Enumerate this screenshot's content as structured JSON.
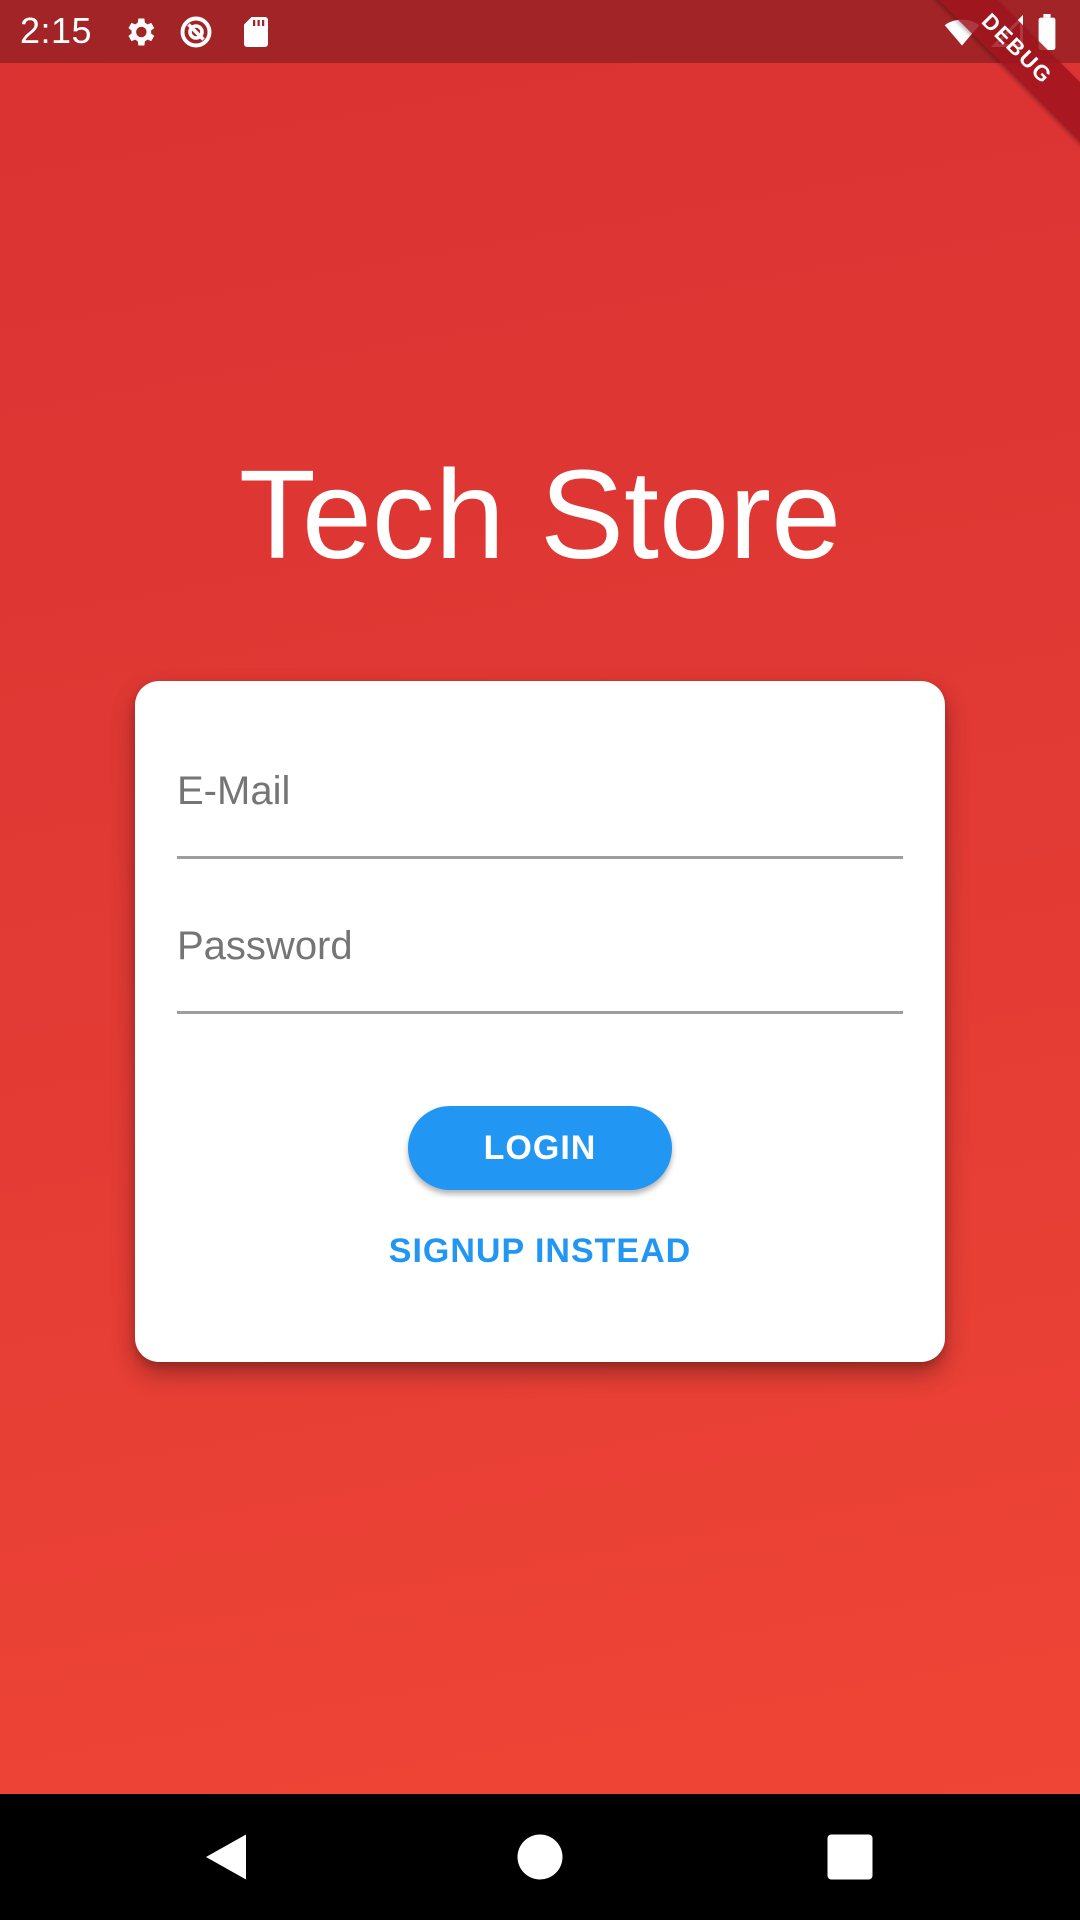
{
  "status_bar": {
    "time": "2:15",
    "icons": [
      "gear-icon",
      "sync-icon",
      "sd-card-icon",
      "wifi-icon",
      "signal-icon",
      "battery-icon"
    ]
  },
  "debug_banner": "DEBUG",
  "app": {
    "title": "Tech Store"
  },
  "login_form": {
    "email_label": "E-Mail",
    "password_label": "Password",
    "login_button": "LOGIN",
    "signup_link": "SIGNUP INSTEAD"
  },
  "nav_bar": {
    "buttons": [
      "back-icon",
      "home-icon",
      "recents-icon"
    ]
  },
  "colors": {
    "status_bar": "#a22427",
    "background": "#e23a34",
    "accent": "#2196f3",
    "card": "#ffffff"
  }
}
